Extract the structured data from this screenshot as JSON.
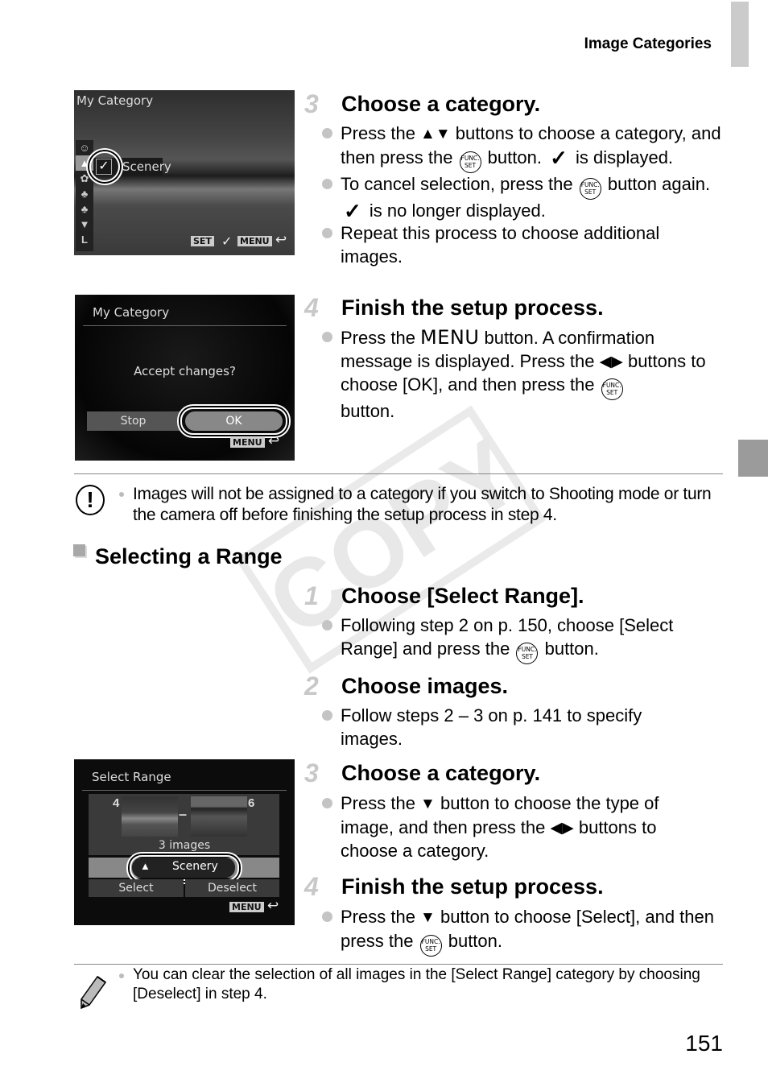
{
  "header": {
    "title": "Image Categories"
  },
  "screens": {
    "my_category_select": {
      "title": "My Category",
      "selected_label": "Scenery",
      "check_glyph": "✓",
      "category_icons": [
        "people-icon",
        "scenery-icon",
        "food-icon",
        "event-icon",
        "event2-icon",
        "down-arrow-icon",
        "resolution-icon"
      ],
      "footer": {
        "set": "SET",
        "check": "✓",
        "menu": "MENU",
        "back": "↩"
      }
    },
    "my_category_confirm": {
      "title": "My Category",
      "message": "Accept changes?",
      "stop_label": "Stop",
      "ok_label": "OK",
      "footer": {
        "menu": "MENU",
        "back": "↩"
      }
    },
    "select_range": {
      "title": "Select Range",
      "start_index": "4",
      "end_index": "6",
      "dash": "–",
      "count_label": "3 images",
      "category_label": "Scenery",
      "select_label": "Select",
      "deselect_label": "Deselect",
      "footer": {
        "menu": "MENU",
        "back": "↩"
      }
    }
  },
  "steps_top": [
    {
      "number": "3",
      "title": "Choose a category.",
      "bullets": [
        {
          "parts": [
            "Press the ",
            "▲▼",
            " buttons to choose a category, and then press the ",
            "FUNC_SET",
            " button. ",
            "✓",
            " is displayed."
          ]
        },
        {
          "parts": [
            "To cancel selection, press the ",
            "FUNC_SET",
            " button again. ",
            "✓",
            " is no longer displayed."
          ]
        },
        {
          "parts": [
            "Repeat this process to choose additional images."
          ]
        }
      ]
    },
    {
      "number": "4",
      "title": "Finish the setup process.",
      "bullets": [
        {
          "parts": [
            "Press the ",
            "MENU",
            " button. A confirmation message is displayed. Press the ",
            "◀▶",
            " buttons to choose [OK], and then press the ",
            "FUNC_SET",
            " button."
          ]
        }
      ]
    }
  ],
  "caution_note": {
    "icon": "caution-icon",
    "text": "Images will not be assigned to a category if you switch to Shooting mode or turn the camera off before finishing the setup process in step 4."
  },
  "section": {
    "title": "Selecting a Range"
  },
  "steps_bottom": [
    {
      "number": "1",
      "title": "Choose [Select Range].",
      "bullets": [
        {
          "parts": [
            "Following step 2 on p. 150, choose [Select Range] and press the ",
            "FUNC_SET",
            " button."
          ]
        }
      ]
    },
    {
      "number": "2",
      "title": "Choose images.",
      "bullets": [
        {
          "parts": [
            "Follow steps 2 – 3 on p. 141 to specify images."
          ]
        }
      ]
    },
    {
      "number": "3",
      "title": "Choose a category.",
      "bullets": [
        {
          "parts": [
            "Press the ",
            "▼",
            " button to choose the type of image, and then press the ",
            "◀▶",
            " buttons to choose a category."
          ]
        }
      ]
    },
    {
      "number": "4",
      "title": "Finish the setup process.",
      "bullets": [
        {
          "parts": [
            "Press the ",
            "▼",
            " button to choose [Select], and then press the ",
            "FUNC_SET",
            " button."
          ]
        }
      ]
    }
  ],
  "memo_note": {
    "icon": "pencil-icon",
    "text": "You can clear the selection of all images in the [Select Range] category by choosing [Deselect] in step 4."
  },
  "func_set_label": {
    "top": "FUNC.",
    "bottom": "SET"
  },
  "watermark": "COPY",
  "page_number": "151",
  "colors": {
    "step_number": "#c8c8c8",
    "bullet": "#c4c4c4",
    "tab_light": "#cbcbcb",
    "tab_dark": "#9b9b9b"
  }
}
